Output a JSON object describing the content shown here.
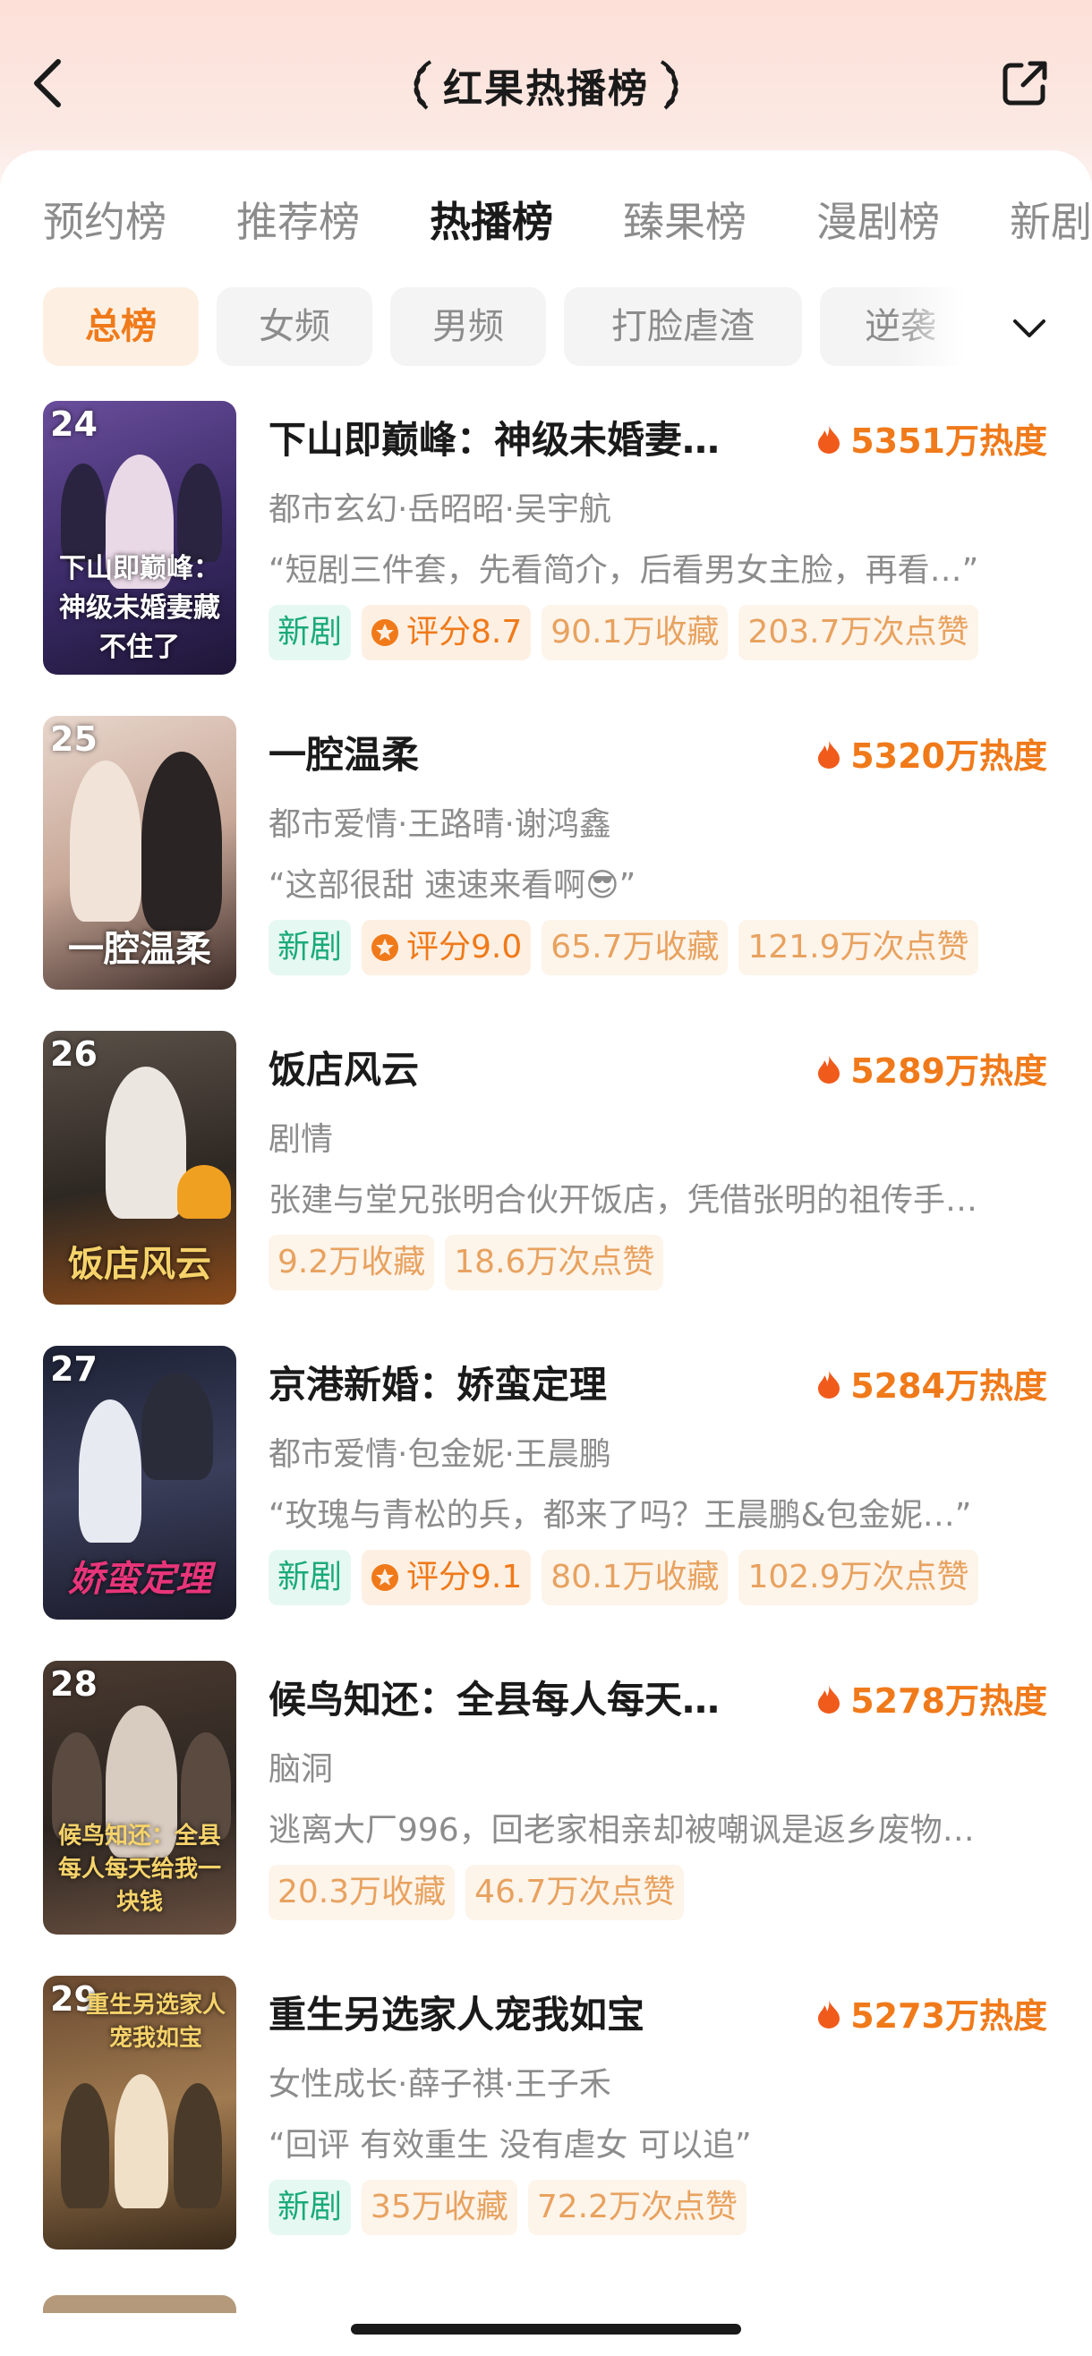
{
  "header": {
    "title": "红果热播榜"
  },
  "tabs": [
    "预约榜",
    "推荐榜",
    "热播榜",
    "臻果榜",
    "漫剧榜",
    "新剧"
  ],
  "chips": [
    "总榜",
    "女频",
    "男频",
    "打脸虐渣",
    "逆袭"
  ],
  "colors": {
    "accent": "#f07a1a",
    "new_badge": "#1aaa7a",
    "stat_badge": "#e8a25f"
  },
  "items": [
    {
      "rank": "24",
      "title": "下山即巅峰：神级未婚妻…",
      "poster_text": "下山即巅峰：神级未婚妻藏不住了",
      "heat": "5351万热度",
      "meta": "都市玄幻·岳昭昭·吴宇航",
      "desc": "“短剧三件套，先看简介，后看男女主脸，再看…”",
      "is_new": "新剧",
      "rating": "评分8.7",
      "favorites": "90.1万收藏",
      "likes": "203.7万次点赞"
    },
    {
      "rank": "25",
      "title": "一腔温柔",
      "poster_text": "一腔温柔",
      "heat": "5320万热度",
      "meta": "都市爱情·王路晴·谢鸿鑫",
      "desc": "“这部很甜 速速来看啊😎”",
      "is_new": "新剧",
      "rating": "评分9.0",
      "favorites": "65.7万收藏",
      "likes": "121.9万次点赞"
    },
    {
      "rank": "26",
      "title": "饭店风云",
      "poster_text": "饭店风云",
      "heat": "5289万热度",
      "meta": "剧情",
      "desc": "张建与堂兄张明合伙开饭店，凭借张明的祖传手…",
      "is_new": "",
      "rating": "",
      "favorites": "9.2万收藏",
      "likes": "18.6万次点赞"
    },
    {
      "rank": "27",
      "title": "京港新婚：娇蛮定理",
      "poster_text": "娇蛮定理",
      "heat": "5284万热度",
      "meta": "都市爱情·包金妮·王晨鹏",
      "desc": "“玫瑰与青松的兵，都来了吗？王晨鹏&包金妮…”",
      "is_new": "新剧",
      "rating": "评分9.1",
      "favorites": "80.1万收藏",
      "likes": "102.9万次点赞"
    },
    {
      "rank": "28",
      "title": "候鸟知还：全县每人每天…",
      "poster_text": "候鸟知还：全县每人每天给我一块钱",
      "heat": "5278万热度",
      "meta": "脑洞",
      "desc": "逃离大厂996，回老家相亲却被嘲讽是返乡废物…",
      "is_new": "",
      "rating": "",
      "favorites": "20.3万收藏",
      "likes": "46.7万次点赞"
    },
    {
      "rank": "29",
      "title": "重生另选家人宠我如宝",
      "poster_text": "重生另选家人宠我如宝",
      "heat": "5273万热度",
      "meta": "女性成长·薛子祺·王子禾",
      "desc": "“回评 有效重生 没有虐女 可以追”",
      "is_new": "新剧",
      "rating": "",
      "favorites": "35万收藏",
      "likes": "72.2万次点赞"
    }
  ]
}
